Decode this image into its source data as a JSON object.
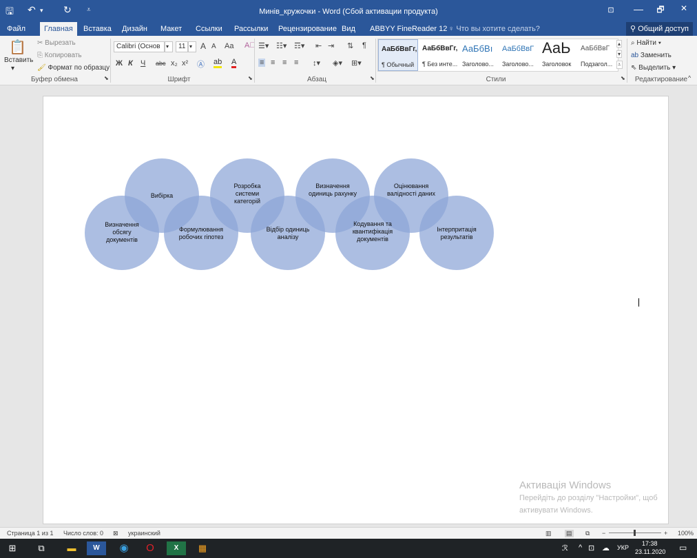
{
  "window": {
    "title": "Минів_кружочки - Word (Сбой активации продукта)",
    "minimize": "—",
    "restore": "🗗",
    "close": "✕",
    "ribbon_display": "⊡"
  },
  "tabs": [
    "Файл",
    "Главная",
    "Вставка",
    "Дизайн",
    "Макет",
    "Ссылки",
    "Рассылки",
    "Рецензирование",
    "Вид",
    "ABBYY FineReader 12"
  ],
  "tell_me": "Что вы хотите сделать?",
  "share": "Общий доступ",
  "clipboard": {
    "paste": "Вставить",
    "cut": "Вырезать",
    "copy": "Копировать",
    "format_painter": "Формат по образцу",
    "label": "Буфер обмена"
  },
  "font": {
    "name": "Calibri (Основ",
    "size": "11",
    "label": "Шрифт",
    "bold": "Ж",
    "italic": "К",
    "underline": "Ч",
    "strike": "abc",
    "sub": "x₂",
    "sup": "x²",
    "grow": "A",
    "shrink": "A",
    "case": "Aa"
  },
  "paragraph": {
    "label": "Абзац"
  },
  "styles": {
    "label": "Стили",
    "items": [
      {
        "sample": "АаБбВвГг,",
        "name": "¶ Обычный"
      },
      {
        "sample": "АаБбВвГг,",
        "name": "¶ Без инте..."
      },
      {
        "sample": "АаБбВı",
        "name": "Заголово..."
      },
      {
        "sample": "АаБбВвГ",
        "name": "Заголово..."
      },
      {
        "sample": "АаЬ",
        "name": "Заголовок"
      },
      {
        "sample": "АаБбВвГ",
        "name": "Подзагол..."
      }
    ]
  },
  "editing": {
    "label": "Редактирование",
    "find": "Найти",
    "replace": "Заменить",
    "select": "Выделить"
  },
  "diagram": {
    "circles": [
      "Вибірка",
      "Розробка системи категорій",
      "Визначення одиниць рахунку",
      "Оцінювання валідності даних",
      "Визначення обсягу документів",
      "Формулювання робочих гіпотез",
      "Відбір одиниць аналізу",
      "Кодування та квантифікація документів",
      "Інтерпритація результатів"
    ]
  },
  "activation": {
    "title": "Активація Windows",
    "line1": "Перейдіть до розділу \"Настройки\", щоб",
    "line2": "активувати Windows."
  },
  "statusbar": {
    "page": "Страница 1 из 1",
    "words": "Число слов: 0",
    "language": "украинский",
    "zoom": "100%"
  },
  "taskbar": {
    "time": "17:38",
    "date": "23.11.2020",
    "lang": "УКР"
  },
  "colors": {
    "accent": "#2b579a",
    "circle_fill": "#8ca5d7"
  }
}
